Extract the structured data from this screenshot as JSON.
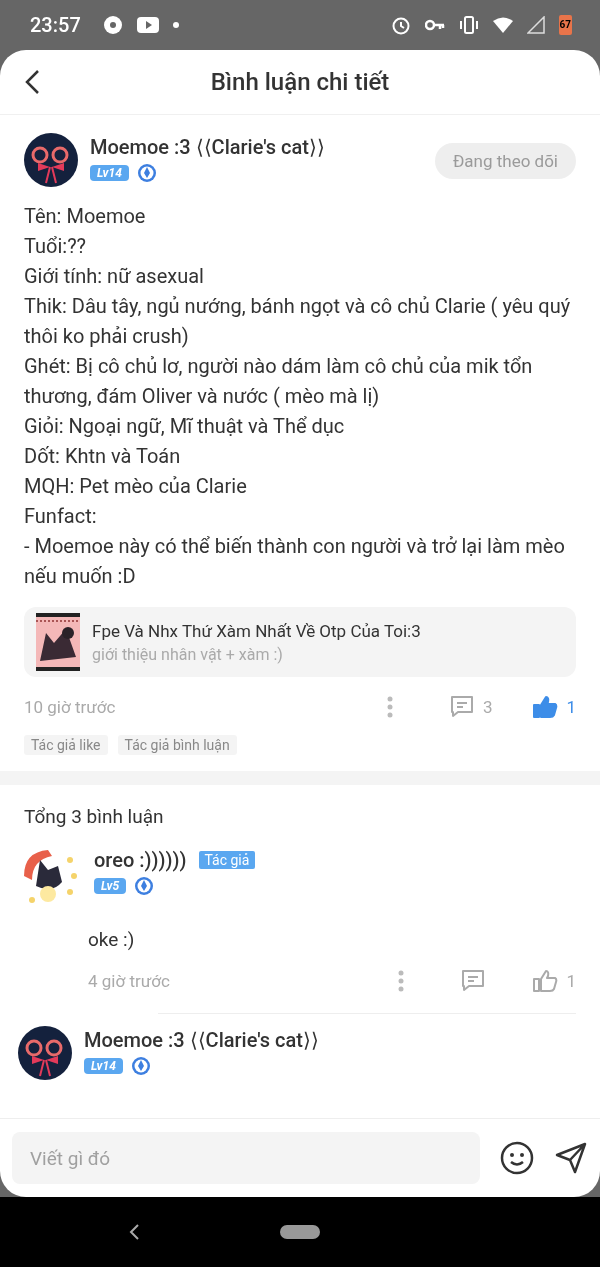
{
  "status_bar": {
    "time": "23:57",
    "battery": "67"
  },
  "header": {
    "title": "Bình luận chi tiết"
  },
  "post": {
    "author": "Moemoe :3 ⟨⟨Clarie's cat⟩⟩",
    "level": "Lv14",
    "follow_button": "Đang theo dõi",
    "following": true,
    "lines": [
      "Tên: Moemoe",
      "Tuổi:??",
      "Giới tính: nữ asexual",
      "Thik: Dâu tây, ngủ nướng, bánh ngọt và cô chủ Clarie ( yêu quý thôi ko phải crush)",
      "Ghét: Bị cô chủ lơ, người nào dám làm cô chủ của mik tổn thương, đám Oliver và nước ( mèo mà lị)",
      "Giỏi: Ngoại ngữ, Mĩ thuật và Thể dục",
      "Dốt: Khtn và Toán",
      "MQH: Pet mèo của Clarie",
      "Funfact:",
      "- Moemoe này có thể biến thành con người và trở lại làm mèo nếu muốn :D"
    ],
    "story": {
      "title": "Fpe Và Nhx Thứ Xàm Nhất Về Otp Của Toi:3",
      "subtitle": "giới thiệu nhân vật + xàm :)"
    },
    "time": "10 giờ trước",
    "comment_count": "3",
    "like_count": "1",
    "liked": true,
    "tags": [
      "Tác giả like",
      "Tác giả bình luận"
    ]
  },
  "comments_header": "Tổng 3 bình luận",
  "comments": [
    {
      "author": "oreo :))))))",
      "author_badge": "Tác giả",
      "level": "Lv5",
      "kind": "stars",
      "text": "oke :)",
      "time": "4 giờ trước",
      "like_count": "1",
      "liked": false
    },
    {
      "author": "Moemoe :3 ⟨⟨Clarie's cat⟩⟩",
      "level": "Lv14",
      "kind": "bow"
    }
  ],
  "composer": {
    "placeholder": "Viết gì đó"
  }
}
